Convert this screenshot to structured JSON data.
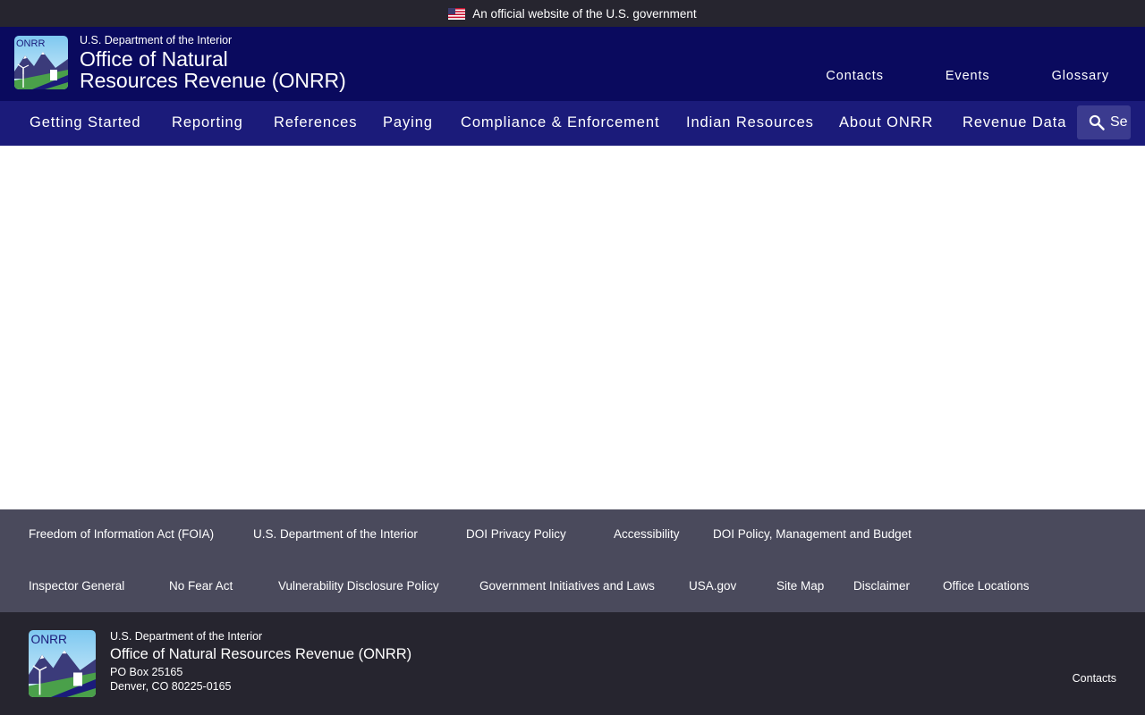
{
  "gov_banner": {
    "text": "An official website of the U.S. government"
  },
  "header": {
    "department": "U.S. Department of the Interior",
    "office_line1": "Office of Natural",
    "office_line2": "Resources Revenue (ONRR)",
    "logo_text": "ONRR",
    "top_links": [
      "Contacts",
      "Events",
      "Glossary"
    ]
  },
  "nav": {
    "items": [
      "Getting Started",
      "Reporting",
      "References",
      "Paying",
      "Compliance & Enforcement",
      "Indian Resources",
      "About ONRR",
      "Revenue Data"
    ],
    "search_placeholder": "Search"
  },
  "footer": {
    "links_row1": [
      "Freedom of Information Act (FOIA)",
      "U.S. Department of the Interior",
      "DOI Privacy Policy",
      "Accessibility",
      "DOI Policy, Management and Budget"
    ],
    "links_row2": [
      "Inspector General",
      "No Fear Act",
      "Vulnerability Disclosure Policy",
      "Government Initiatives and Laws",
      "USA.gov",
      "Site Map",
      "Disclaimer",
      "Office Locations"
    ],
    "department": "U.S. Department of the Interior",
    "office": "Office of Natural Resources Revenue (ONRR)",
    "address_line1": "PO Box 25165",
    "address_line2": "Denver, CO 80225-0165",
    "contacts": "Contacts"
  },
  "colors": {
    "banner_bg": "#26252f",
    "header_bg": "#0a0a5e",
    "nav_bg": "#1b1b7a",
    "footer_links_bg": "#4a4a5c",
    "footer_bottom_bg": "#26252f"
  }
}
